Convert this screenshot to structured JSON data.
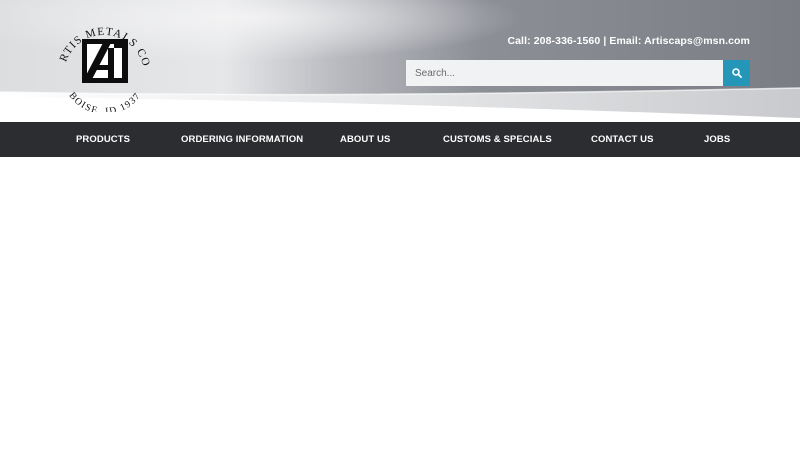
{
  "brand": {
    "name": "ARTIS METALS CO.",
    "location": "BOISE, ID 1937",
    "logo_letter": "A"
  },
  "header": {
    "contact": "Call: 208-336-1560 | Email: Artiscaps@msn.com"
  },
  "search": {
    "placeholder": "Search...",
    "value": "",
    "button_icon": "search-icon",
    "button_color": "#2496b7"
  },
  "nav": {
    "items": [
      {
        "label": "PRODUCTS"
      },
      {
        "label": "ORDERING INFORMATION"
      },
      {
        "label": "ABOUT US"
      },
      {
        "label": "CUSTOMS & SPECIALS"
      },
      {
        "label": "CONTACT US"
      },
      {
        "label": "JOBS"
      }
    ],
    "background": "#2c2d31",
    "text_color": "#ffffff"
  }
}
